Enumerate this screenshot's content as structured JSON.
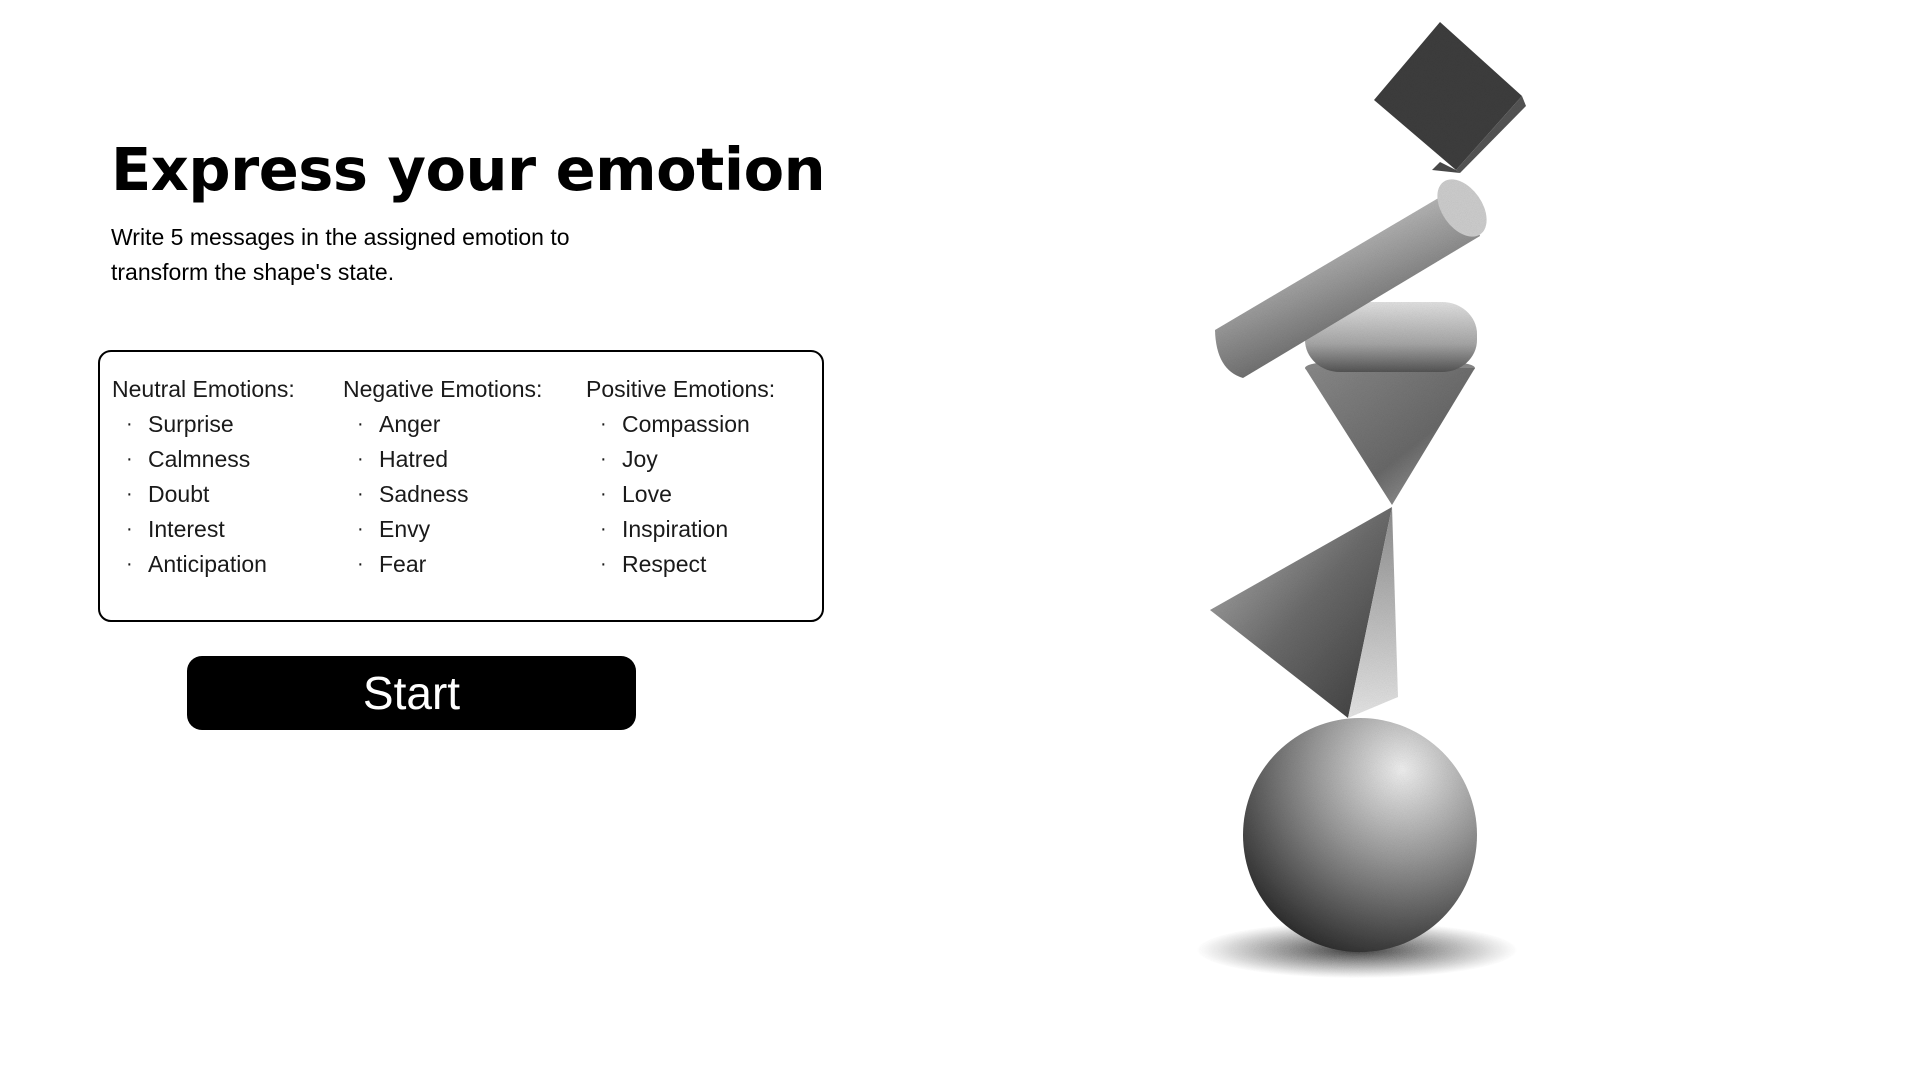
{
  "header": {
    "title": "Express your emotion",
    "subtitle": "Write 5 messages in the assigned emotion to transform the shape's state."
  },
  "emotions": {
    "neutral": {
      "heading": "Neutral Emotions:",
      "items": [
        "Surprise",
        "Calmness",
        "Doubt",
        "Interest",
        "Anticipation"
      ]
    },
    "negative": {
      "heading": "Negative Emotions:",
      "items": [
        "Anger",
        "Hatred",
        "Sadness",
        "Envy",
        "Fear"
      ]
    },
    "positive": {
      "heading": "Positive Emotions:",
      "items": [
        "Compassion",
        "Joy",
        "Love",
        "Inspiration",
        "Respect"
      ]
    }
  },
  "actions": {
    "start_label": "Start"
  },
  "colors": {
    "background": "#ffffff",
    "text": "#000000",
    "button_bg": "#000000",
    "button_text": "#ffffff"
  }
}
